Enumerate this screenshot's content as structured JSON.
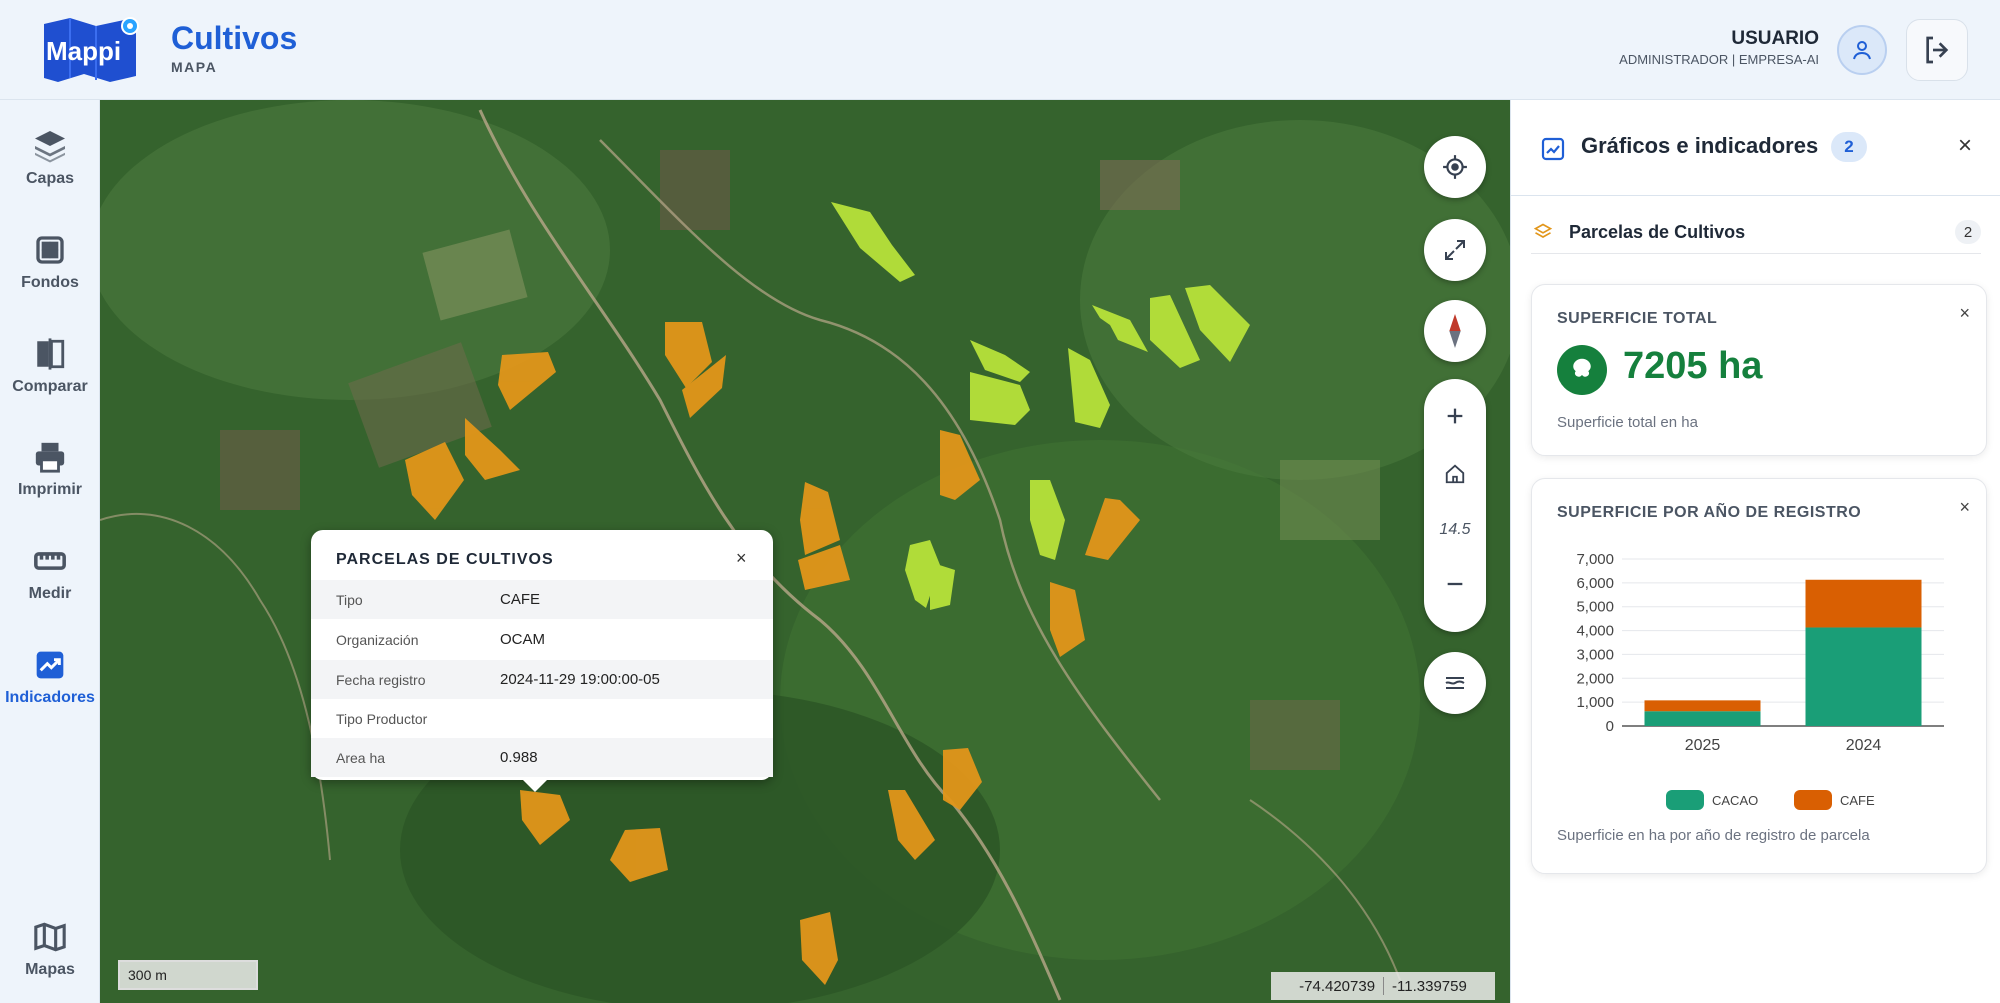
{
  "header": {
    "logo_text": "Mappi",
    "title": "Cultivos",
    "subtitle": "MAPA",
    "user_name": "USUARIO",
    "user_role": "ADMINISTRADOR | EMPRESA-AI"
  },
  "sidebar": {
    "items": [
      {
        "label": "Capas",
        "icon": "layers-icon"
      },
      {
        "label": "Fondos",
        "icon": "grid-icon"
      },
      {
        "label": "Comparar",
        "icon": "compare-icon"
      },
      {
        "label": "Imprimir",
        "icon": "printer-icon"
      },
      {
        "label": "Medir",
        "icon": "ruler-icon"
      },
      {
        "label": "Indicadores",
        "icon": "chart-line-icon",
        "active": true
      },
      {
        "label": "Mapas",
        "icon": "map-icon"
      }
    ]
  },
  "map": {
    "zoom_level": "14.5",
    "scale_label": "300 m",
    "longitude": "-74.420739",
    "latitude": "-11.339759"
  },
  "popup": {
    "title": "PARCELAS DE CULTIVOS",
    "close": "×",
    "rows": [
      {
        "key": "Tipo",
        "value": "CAFE"
      },
      {
        "key": "Organización",
        "value": "OCAM"
      },
      {
        "key": "Fecha registro",
        "value": "2024-11-29 19:00:00-05"
      },
      {
        "key": "Tipo Productor",
        "value": ""
      },
      {
        "key": "Area ha",
        "value": "0.988"
      }
    ]
  },
  "panel": {
    "title": "Gráficos e indicadores",
    "count": "2",
    "close": "×",
    "layer_name": "Parcelas de Cultivos",
    "layer_count": "2",
    "card1": {
      "title": "SUPERFICIE TOTAL",
      "value": "7205 ha",
      "description": "Superficie total en ha",
      "close": "×"
    },
    "card2": {
      "title": "SUPERFICIE POR AÑO DE REGISTRO",
      "description": "Superficie en ha por año de registro de parcela",
      "close": "×"
    }
  },
  "colors": {
    "cacao": "#1a9e77",
    "cafe": "#d95f02",
    "accent": "#1f5fd6",
    "parcel_cafe": "#e2961a",
    "parcel_cacao": "#b7e23a"
  },
  "chart_data": {
    "type": "bar",
    "stacked": true,
    "categories": [
      "2025",
      "2024"
    ],
    "series": [
      {
        "name": "CACAO",
        "values": [
          620,
          4130
        ]
      },
      {
        "name": "CAFE",
        "values": [
          455,
          2000
        ]
      }
    ],
    "ylim": [
      0,
      7000
    ],
    "yticks": [
      "0",
      "1,000",
      "2,000",
      "3,000",
      "4,000",
      "5,000",
      "6,000",
      "7,000"
    ],
    "grid": true,
    "legend": "bottom"
  }
}
